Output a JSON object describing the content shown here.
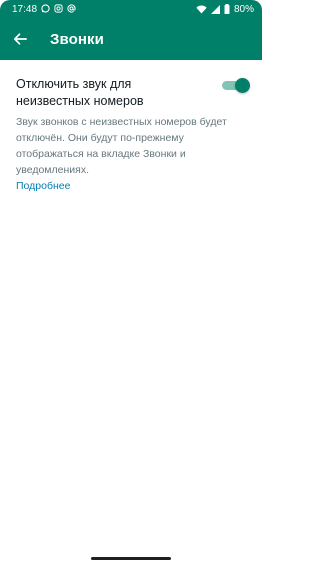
{
  "status_bar": {
    "time": "17:48",
    "battery": "80%",
    "notification_icons": [
      "whatsapp-icon",
      "instagram-icon",
      "at-sign-icon"
    ],
    "indicator_icons": [
      "wifi-icon",
      "signal-icon",
      "battery-icon"
    ]
  },
  "app_bar": {
    "title": "Звонки",
    "back_icon": "arrow-back-icon",
    "background_color": "#008069"
  },
  "setting": {
    "title": "Отключить звук для неизвестных номеров",
    "description": "Звук звонков с неизвестных номеров будет отключён. Они будут по-прежнему отображаться на вкладке Звонки и уведомлениях.",
    "learn_more": "Подробнее",
    "toggle_on": true,
    "accent_color": "#008069"
  }
}
